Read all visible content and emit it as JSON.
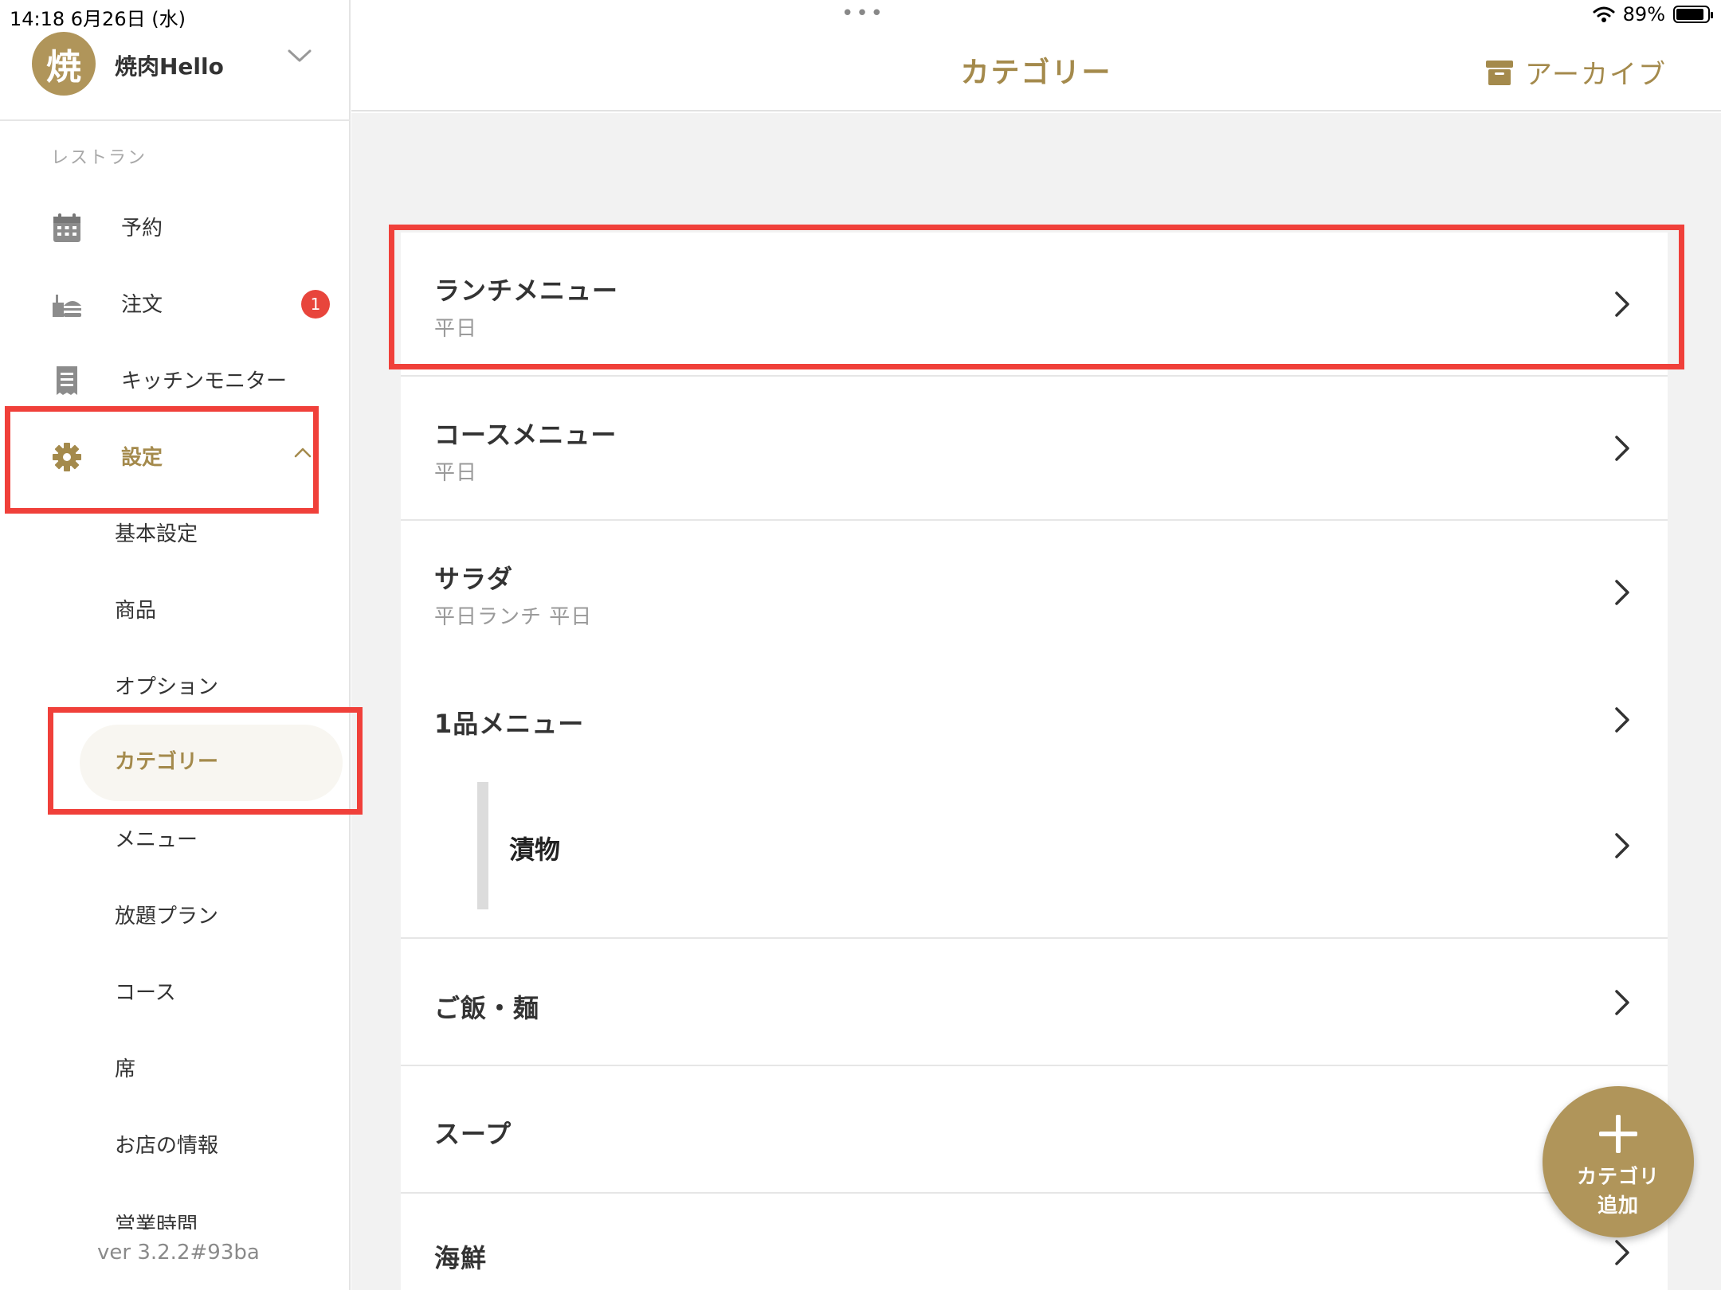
{
  "status_bar": {
    "time_date": "14:18   6月26日 (水)",
    "dots": "•••",
    "battery_text": "89%",
    "battery_level": 0.89
  },
  "account": {
    "avatar_char": "焼",
    "name": "焼肉Hello"
  },
  "sidebar": {
    "section_label": "レストラン",
    "nav_items": [
      {
        "label": "予約",
        "icon": "calendar-icon"
      },
      {
        "label": "注文",
        "icon": "food-tray-icon",
        "badge": "1"
      },
      {
        "label": "キッチンモニター",
        "icon": "receipt-icon"
      },
      {
        "label": "設定",
        "icon": "gear-icon",
        "active": true
      }
    ],
    "sub_items": [
      {
        "label": "基本設定"
      },
      {
        "label": "商品"
      },
      {
        "label": "オプション"
      },
      {
        "label": "カテゴリー",
        "active": true
      },
      {
        "label": "メニュー"
      },
      {
        "label": "放題プラン"
      },
      {
        "label": "コース"
      },
      {
        "label": "席"
      },
      {
        "label": "お店の情報"
      },
      {
        "label": "営業時間"
      }
    ],
    "version": "ver 3.2.2#93ba"
  },
  "header": {
    "title": "カテゴリー",
    "archive_label": "アーカイブ",
    "archive_icon": "archive-box-icon"
  },
  "categories": [
    {
      "title": "ランチメニュー",
      "subtitle": "平日"
    },
    {
      "title": "コースメニュー",
      "subtitle": "平日"
    },
    {
      "title": "サラダ",
      "subtitle": "平日ランチ 平日"
    },
    {
      "title": "1品メニュー",
      "children": [
        {
          "title": "漬物"
        }
      ]
    },
    {
      "title": "ご飯・麺"
    },
    {
      "title": "スープ"
    },
    {
      "title": "海鮮"
    }
  ],
  "fab": {
    "line1": "カテゴリ",
    "line2": "追加"
  },
  "colors": {
    "accent": "#a48a4c",
    "fab": "#b0955a",
    "badge": "#e8453c",
    "highlight": "#f0403a"
  }
}
